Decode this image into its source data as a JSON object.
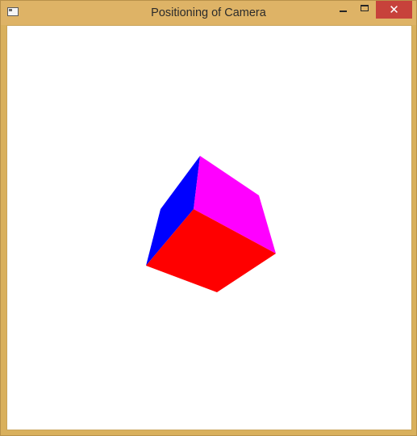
{
  "window": {
    "title": "Positioning of Camera",
    "close_glyph": "✕"
  },
  "scene": {
    "object": "cube",
    "faces": [
      {
        "name": "front-face",
        "color": "#ff0000"
      },
      {
        "name": "top-face",
        "color": "#ff00ff"
      },
      {
        "name": "left-face",
        "color": "#0000ff"
      }
    ]
  },
  "icons": {
    "app": "window-app-icon",
    "minimize": "minimize-icon",
    "maximize": "maximize-icon",
    "close": "close-icon"
  }
}
